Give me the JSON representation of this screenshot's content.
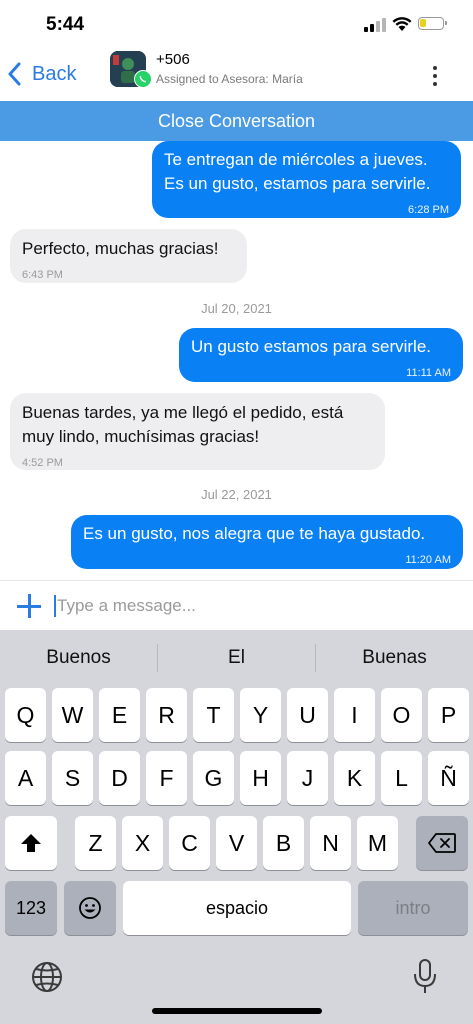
{
  "status_bar": {
    "time": "5:44"
  },
  "header": {
    "back_label": "Back",
    "contact_phone": "+506",
    "assigned_text": "Assigned to Asesora: María"
  },
  "close_conversation_label": "Close Conversation",
  "messages": [
    {
      "direction": "out",
      "text": "Te entregan de miércoles a jueves. Es un gusto, estamos para servirle.",
      "time": "6:28 PM"
    },
    {
      "direction": "in",
      "text": "Perfecto, muchas gracias!",
      "time": "6:43 PM"
    },
    {
      "type": "date",
      "text": "Jul 20, 2021"
    },
    {
      "direction": "out",
      "text": "Un gusto estamos para servirle.",
      "time": "11:11 AM"
    },
    {
      "direction": "in",
      "text": "Buenas tardes, ya me llegó el pedido, está muy lindo, muchísimas gracias!",
      "time": "4:52 PM"
    },
    {
      "type": "date",
      "text": "Jul 22, 2021"
    },
    {
      "direction": "out",
      "text": "Es un gusto, nos alegra que te haya gustado.",
      "time": "11:20 AM"
    }
  ],
  "composer": {
    "placeholder": "Type a message...",
    "value": ""
  },
  "keyboard": {
    "suggestions": [
      "Buenos",
      "El",
      "Buenas"
    ],
    "row1": [
      "Q",
      "W",
      "E",
      "R",
      "T",
      "Y",
      "U",
      "I",
      "O",
      "P"
    ],
    "row2": [
      "A",
      "S",
      "D",
      "F",
      "G",
      "H",
      "J",
      "K",
      "L",
      "Ñ"
    ],
    "row3": [
      "Z",
      "X",
      "C",
      "V",
      "B",
      "N",
      "M"
    ],
    "numbers_label": "123",
    "space_label": "espacio",
    "return_label": "intro"
  },
  "colors": {
    "accent": "#2a7ce3",
    "close_bar": "#4a9be3",
    "outgoing_bubble": "#0a80f5",
    "incoming_bubble": "#eeeef0",
    "whatsapp": "#25d366"
  },
  "icons": [
    "chevron-left-icon",
    "whatsapp-icon",
    "more-vertical-icon",
    "plus-icon",
    "shift-icon",
    "backspace-icon",
    "emoji-icon",
    "globe-icon",
    "microphone-icon"
  ]
}
